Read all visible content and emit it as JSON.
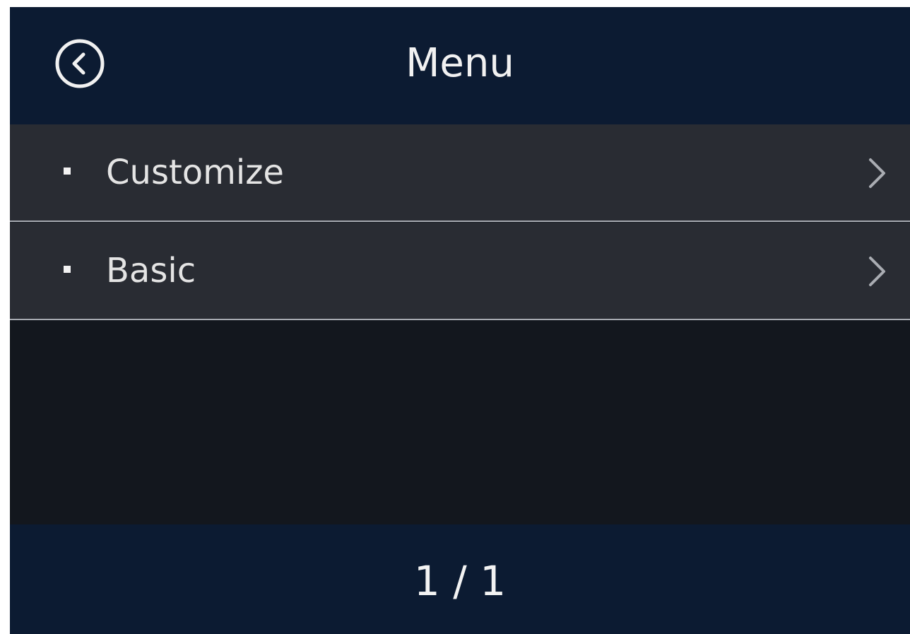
{
  "header": {
    "title": "Menu",
    "back_icon": "back-circle-icon"
  },
  "menu": {
    "items": [
      {
        "label": "Customize",
        "bullet_icon": "bullet-icon",
        "arrow_icon": "chevron-right-icon"
      },
      {
        "label": "Basic",
        "bullet_icon": "bullet-icon",
        "arrow_icon": "chevron-right-icon"
      }
    ]
  },
  "footer": {
    "page_indicator": "1 / 1"
  },
  "colors": {
    "header_bg": "#0c1b32",
    "row_bg": "#292c33",
    "body_bg": "#13171e",
    "divider": "#a7abb2",
    "text": "#f1f1f1"
  }
}
